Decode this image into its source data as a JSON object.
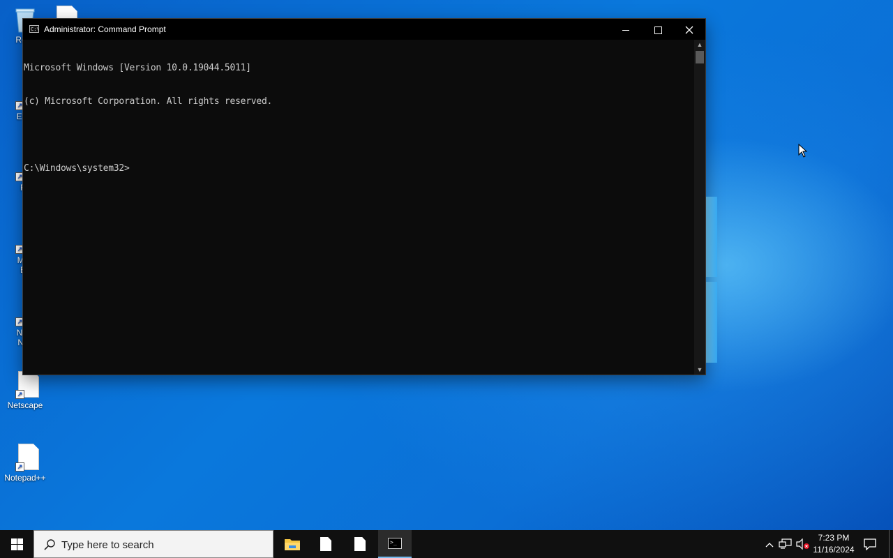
{
  "desktop": {
    "icons": [
      {
        "label": "Recy"
      },
      {
        "label": "Ever"
      },
      {
        "label": "Fir"
      },
      {
        "label": "Micr"
      },
      {
        "label": "Ec"
      },
      {
        "label": "Nets"
      },
      {
        "label": "Nav"
      },
      {
        "label": "Netscape"
      },
      {
        "label": "Notepad++"
      }
    ]
  },
  "window": {
    "title": "Administrator: Command Prompt",
    "icon": "cmd-icon",
    "controls": {
      "minimize": "minimize-icon",
      "maximize": "maximize-icon",
      "close": "close-icon"
    },
    "console_lines": [
      "Microsoft Windows [Version 10.0.19044.5011]",
      "(c) Microsoft Corporation. All rights reserved.",
      "",
      "C:\\Windows\\system32>"
    ]
  },
  "taskbar": {
    "search_placeholder": "Type here to search",
    "apps": [
      "file-explorer-icon",
      "document-icon",
      "document-icon",
      "command-prompt-icon"
    ],
    "active_app": "command-prompt-icon",
    "clock": {
      "time": "7:23 PM",
      "date": "11/16/2024"
    }
  },
  "colors": {
    "console_bg": "#0c0c0c",
    "console_text": "#cccccc",
    "taskbar_bg": "#101010",
    "desktop_blue": "#0a78dc",
    "active_indicator": "#76b9ed"
  }
}
